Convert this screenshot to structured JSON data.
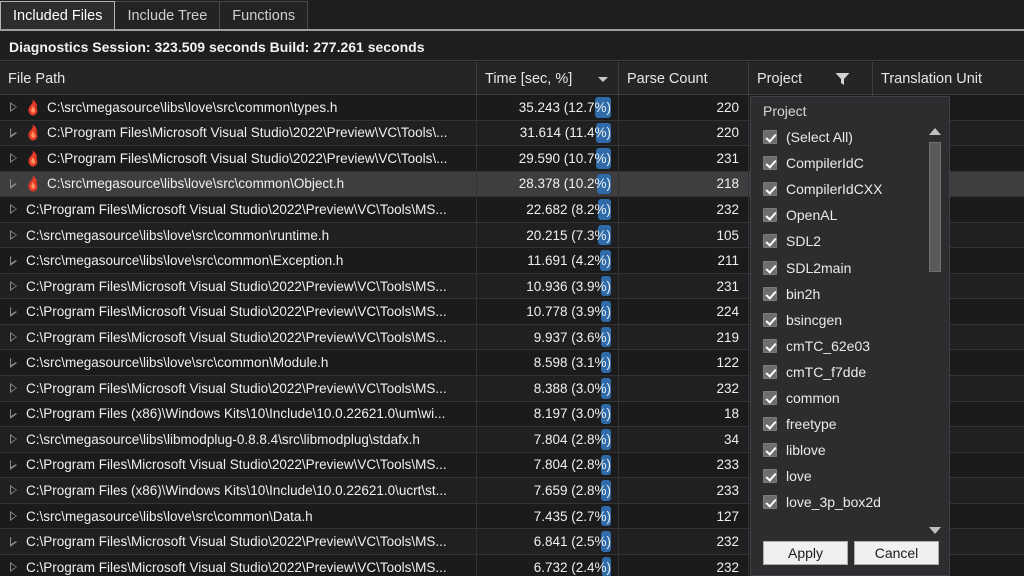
{
  "tabs": [
    {
      "label": "Included Files",
      "active": true
    },
    {
      "label": "Include Tree",
      "active": false
    },
    {
      "label": "Functions",
      "active": false
    }
  ],
  "summary": {
    "text": "Diagnostics Session: 323.509 seconds  Build: 277.261 seconds"
  },
  "columns": {
    "file_path": "File Path",
    "time": "Time [sec, %]",
    "parse_count": "Parse Count",
    "project": "Project",
    "translation_unit": "Translation Unit"
  },
  "rows": [
    {
      "path": "C:\\src\\megasource\\libs\\love\\src\\common\\types.h",
      "hot": true,
      "time": "35.243 (12.7%)",
      "pct": 12.7,
      "parse": "220",
      "selected": false
    },
    {
      "path": "C:\\Program Files\\Microsoft Visual Studio\\2022\\Preview\\VC\\Tools\\...",
      "hot": true,
      "time": "31.614 (11.4%)",
      "pct": 11.4,
      "parse": "220",
      "selected": false
    },
    {
      "path": "C:\\Program Files\\Microsoft Visual Studio\\2022\\Preview\\VC\\Tools\\...",
      "hot": true,
      "time": "29.590 (10.7%)",
      "pct": 10.7,
      "parse": "231",
      "selected": false
    },
    {
      "path": "C:\\src\\megasource\\libs\\love\\src\\common\\Object.h",
      "hot": true,
      "time": "28.378 (10.2%)",
      "pct": 10.2,
      "parse": "218",
      "selected": true
    },
    {
      "path": "C:\\Program Files\\Microsoft Visual Studio\\2022\\Preview\\VC\\Tools\\MS...",
      "hot": false,
      "time": "22.682 (8.2%)",
      "pct": 8.2,
      "parse": "232",
      "selected": false
    },
    {
      "path": "C:\\src\\megasource\\libs\\love\\src\\common\\runtime.h",
      "hot": false,
      "time": "20.215 (7.3%)",
      "pct": 7.3,
      "parse": "105",
      "selected": false
    },
    {
      "path": "C:\\src\\megasource\\libs\\love\\src\\common\\Exception.h",
      "hot": false,
      "time": "11.691 (4.2%)",
      "pct": 4.2,
      "parse": "211",
      "selected": false
    },
    {
      "path": "C:\\Program Files\\Microsoft Visual Studio\\2022\\Preview\\VC\\Tools\\MS...",
      "hot": false,
      "time": "10.936 (3.9%)",
      "pct": 3.9,
      "parse": "231",
      "selected": false
    },
    {
      "path": "C:\\Program Files\\Microsoft Visual Studio\\2022\\Preview\\VC\\Tools\\MS...",
      "hot": false,
      "time": "10.778 (3.9%)",
      "pct": 3.9,
      "parse": "224",
      "selected": false
    },
    {
      "path": "C:\\Program Files\\Microsoft Visual Studio\\2022\\Preview\\VC\\Tools\\MS...",
      "hot": false,
      "time": "9.937 (3.6%)",
      "pct": 3.6,
      "parse": "219",
      "selected": false
    },
    {
      "path": "C:\\src\\megasource\\libs\\love\\src\\common\\Module.h",
      "hot": false,
      "time": "8.598 (3.1%)",
      "pct": 3.1,
      "parse": "122",
      "selected": false
    },
    {
      "path": "C:\\Program Files\\Microsoft Visual Studio\\2022\\Preview\\VC\\Tools\\MS...",
      "hot": false,
      "time": "8.388 (3.0%)",
      "pct": 3.0,
      "parse": "232",
      "selected": false
    },
    {
      "path": "C:\\Program Files (x86)\\Windows Kits\\10\\Include\\10.0.22621.0\\um\\wi...",
      "hot": false,
      "time": "8.197 (3.0%)",
      "pct": 3.0,
      "parse": "18",
      "selected": false
    },
    {
      "path": "C:\\src\\megasource\\libs\\libmodplug-0.8.8.4\\src\\libmodplug\\stdafx.h",
      "hot": false,
      "time": "7.804 (2.8%)",
      "pct": 2.8,
      "parse": "34",
      "selected": false
    },
    {
      "path": "C:\\Program Files\\Microsoft Visual Studio\\2022\\Preview\\VC\\Tools\\MS...",
      "hot": false,
      "time": "7.804 (2.8%)",
      "pct": 2.8,
      "parse": "233",
      "selected": false
    },
    {
      "path": "C:\\Program Files (x86)\\Windows Kits\\10\\Include\\10.0.22621.0\\ucrt\\st...",
      "hot": false,
      "time": "7.659 (2.8%)",
      "pct": 2.8,
      "parse": "233",
      "selected": false
    },
    {
      "path": "C:\\src\\megasource\\libs\\love\\src\\common\\Data.h",
      "hot": false,
      "time": "7.435 (2.7%)",
      "pct": 2.7,
      "parse": "127",
      "selected": false
    },
    {
      "path": "C:\\Program Files\\Microsoft Visual Studio\\2022\\Preview\\VC\\Tools\\MS...",
      "hot": false,
      "time": "6.841 (2.5%)",
      "pct": 2.5,
      "parse": "232",
      "selected": false
    },
    {
      "path": "C:\\Program Files\\Microsoft Visual Studio\\2022\\Preview\\VC\\Tools\\MS...",
      "hot": false,
      "time": "6.732 (2.4%)",
      "pct": 2.4,
      "parse": "232",
      "selected": false
    }
  ],
  "filter_popup": {
    "title": "Project",
    "items": [
      {
        "label": "(Select All)",
        "checked": true
      },
      {
        "label": "CompilerIdC",
        "checked": true
      },
      {
        "label": "CompilerIdCXX",
        "checked": true
      },
      {
        "label": "OpenAL",
        "checked": true
      },
      {
        "label": "SDL2",
        "checked": true
      },
      {
        "label": "SDL2main",
        "checked": true
      },
      {
        "label": "bin2h",
        "checked": true
      },
      {
        "label": "bsincgen",
        "checked": true
      },
      {
        "label": "cmTC_62e03",
        "checked": true
      },
      {
        "label": "cmTC_f7dde",
        "checked": true
      },
      {
        "label": "common",
        "checked": true
      },
      {
        "label": "freetype",
        "checked": true
      },
      {
        "label": "liblove",
        "checked": true
      },
      {
        "label": "love",
        "checked": true
      },
      {
        "label": "love_3p_box2d",
        "checked": true
      }
    ],
    "apply_label": "Apply",
    "cancel_label": "Cancel"
  },
  "colors": {
    "accent_bar": "#2f6ba8",
    "selection": "#3e3e40",
    "hot_icon": "#e23b26",
    "background": "#1e1e1e"
  }
}
